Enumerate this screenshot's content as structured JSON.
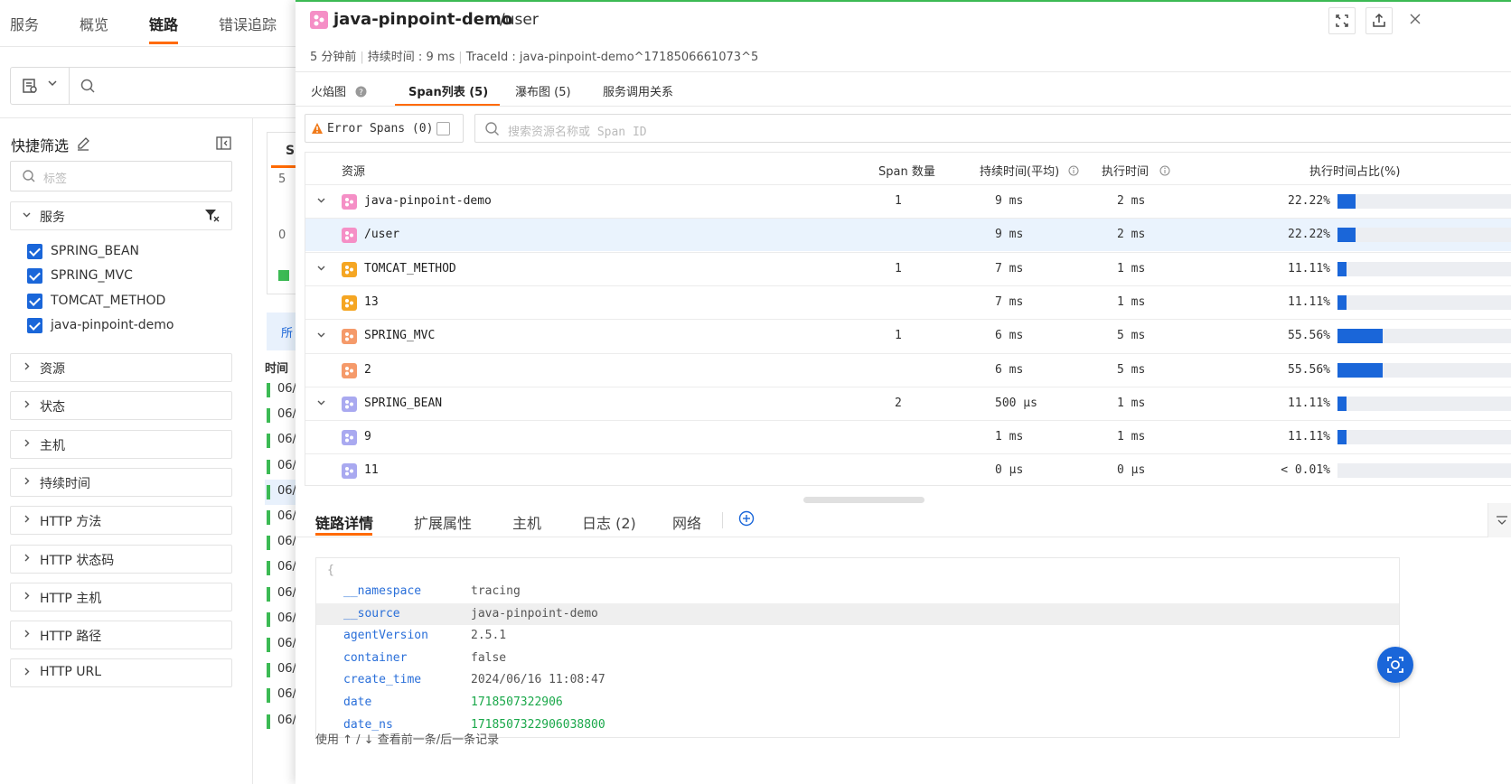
{
  "topnav": {
    "tabs": [
      "服务",
      "概览",
      "链路",
      "错误追踪"
    ],
    "active": "链路"
  },
  "quick_filter": {
    "title": "快捷筛选",
    "tag_placeholder": "标签",
    "service_facet": "服务",
    "services": [
      "SPRING_BEAN",
      "SPRING_MVC",
      "TOMCAT_METHOD",
      "java-pinpoint-demo"
    ],
    "facets": [
      "资源",
      "状态",
      "主机",
      "持续时间",
      "HTTP 方法",
      "HTTP 状态码",
      "HTTP 主机",
      "HTTP 路径",
      "HTTP URL"
    ]
  },
  "background": {
    "card_title": "Sp",
    "axis_top": "5",
    "axis_bottom": "0",
    "link_text": "所",
    "time_header": "时间",
    "row_prefix": "06/"
  },
  "drawer": {
    "app_name": "java-pinpoint-demo",
    "resource": "/user",
    "meta": {
      "ago": "5 分钟前",
      "duration": "持续时间 : 9 ms",
      "trace_id": "TraceId : java-pinpoint-demo^1718506661073^5"
    },
    "subtabs": [
      "火焰图",
      "Span列表 (5)",
      "瀑布图 (5)",
      "服务调用关系"
    ],
    "error_spans_label": "Error Spans (0)",
    "search_placeholder": "搜索资源名称或 Span ID",
    "table_headers": [
      "资源",
      "Span 数量",
      "持续时间(平均)",
      "执行时间",
      "执行时间占比(%)"
    ],
    "rows": [
      {
        "name": "java-pinpoint-demo",
        "count": "1",
        "duration": "9 ms",
        "exec": "2 ms",
        "pct": "22.22%",
        "frac": 0.2222,
        "group": true,
        "color": "#f58fc6"
      },
      {
        "name": "/user",
        "count": "",
        "duration": "9 ms",
        "exec": "2 ms",
        "pct": "22.22%",
        "frac": 0.2222,
        "group": false,
        "color": "#f58fc6"
      },
      {
        "name": "TOMCAT_METHOD",
        "count": "1",
        "duration": "7 ms",
        "exec": "1 ms",
        "pct": "11.11%",
        "frac": 0.1111,
        "group": true,
        "color": "#f5a623"
      },
      {
        "name": "13",
        "count": "",
        "duration": "7 ms",
        "exec": "1 ms",
        "pct": "11.11%",
        "frac": 0.1111,
        "group": false,
        "color": "#f5a623"
      },
      {
        "name": "SPRING_MVC",
        "count": "1",
        "duration": "6 ms",
        "exec": "5 ms",
        "pct": "55.56%",
        "frac": 0.5556,
        "group": true,
        "color": "#f59a6a"
      },
      {
        "name": "2",
        "count": "",
        "duration": "6 ms",
        "exec": "5 ms",
        "pct": "55.56%",
        "frac": 0.5556,
        "group": false,
        "color": "#f59a6a"
      },
      {
        "name": "SPRING_BEAN",
        "count": "2",
        "duration": "500 µs",
        "exec": "1 ms",
        "pct": "11.11%",
        "frac": 0.1111,
        "group": true,
        "color": "#a9a9f0"
      },
      {
        "name": "9",
        "count": "",
        "duration": "1 ms",
        "exec": "1 ms",
        "pct": "11.11%",
        "frac": 0.1111,
        "group": false,
        "color": "#a9a9f0"
      },
      {
        "name": "11",
        "count": "",
        "duration": "0 µs",
        "exec": "0 µs",
        "pct": "< 0.01%",
        "frac": 0.0001,
        "group": false,
        "color": "#a9a9f0"
      }
    ],
    "bottom_tabs": [
      "链路详情",
      "扩展属性",
      "主机",
      "日志 (2)",
      "网络"
    ],
    "json_open": "{",
    "details": [
      {
        "k": "__namespace",
        "v": "tracing",
        "num": false
      },
      {
        "k": "__source",
        "v": "java-pinpoint-demo",
        "num": false
      },
      {
        "k": "agentVersion",
        "v": "2.5.1",
        "num": false
      },
      {
        "k": "container",
        "v": "false",
        "num": false
      },
      {
        "k": "create_time",
        "v": "2024/06/16 11:08:47",
        "num": false
      },
      {
        "k": "date",
        "v": "1718507322906",
        "num": true
      },
      {
        "k": "date_ns",
        "v": "1718507322906038800",
        "num": true
      }
    ],
    "footer": "使用 ↑ / ↓ 查看前一条/后一条记录"
  }
}
